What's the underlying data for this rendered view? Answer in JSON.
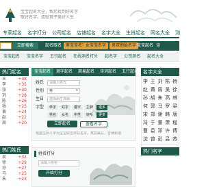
{
  "header": {
    "slogan_line1": "宝宝起名大全，帮您找到好名字",
    "slogan_line2": "取好名字，成就孩子美好人生"
  },
  "top_nav": [
    "专家起名",
    "名字打分",
    "公司起名",
    "店铺起名",
    "名字大全",
    "生肖起名",
    "网名大全",
    "测"
  ],
  "search": {
    "button_label": "立即搜索"
  },
  "green_nav": [
    {
      "label": "起名取名",
      "highlight": false
    },
    {
      "label": "男宝宝名字",
      "highlight": true
    },
    {
      "label": "女宝宝名字",
      "highlight": true
    },
    {
      "label": "男双胞胎名字",
      "highlight": true
    },
    {
      "label": "宝宝起名",
      "highlight": false
    },
    {
      "label": "诗",
      "highlight": false
    }
  ],
  "strip": [
    "宝宝起名",
    "宝宝名字",
    "五行起名",
    "在线测名打分",
    "起名字",
    "公司测名",
    "起名大全"
  ],
  "left_panel_1": {
    "title": "热门起名",
    "rows": [
      {
        "name": "王",
        "num": "+38"
      },
      {
        "name": "李",
        "num": "+35"
      },
      {
        "name": "张",
        "num": "+30"
      },
      {
        "name": "刘",
        "num": "+28"
      },
      {
        "name": "陈",
        "num": "+26"
      },
      {
        "name": "杨",
        "num": "+25"
      },
      {
        "name": "黄",
        "num": "+24"
      },
      {
        "name": "赵",
        "num": "+22"
      },
      {
        "name": "周",
        "num": "+20"
      }
    ]
  },
  "left_panel_2": {
    "title": "热门姓氏",
    "rows": [
      {
        "name": "吴",
        "num": "+32"
      },
      {
        "name": "徐",
        "num": "+29"
      },
      {
        "name": "孙",
        "num": "+27"
      },
      {
        "name": "马",
        "num": "+25"
      },
      {
        "name": "朱",
        "num": "+23"
      },
      {
        "name": "胡",
        "num": "+21"
      },
      {
        "name": "郭",
        "num": "+19"
      },
      {
        "name": "何",
        "num": "+18"
      }
    ]
  },
  "center_tabs": [
    {
      "label": "宝宝起名",
      "active": true
    },
    {
      "label": "测字起名",
      "active": false
    },
    {
      "label": "周易起名",
      "active": false
    },
    {
      "label": "诗词起名",
      "active": false
    },
    {
      "label": "五行起名",
      "active": false
    }
  ],
  "form": {
    "surname_label": "姓氏",
    "surname_placeholder": "请输入姓氏",
    "gender_label": "性别",
    "gender_value": "男",
    "birthday_label": "生日",
    "birthday_placeholder": "选择出生日期",
    "options_label": "字型",
    "chips_row1": [
      "单字",
      "双字",
      "叠字",
      "生僻",
      "更多"
    ],
    "chips_row2": [
      "男名",
      "女名",
      "中性",
      "好听",
      "更多"
    ],
    "submit_label": "立即起名",
    "secondary_label": "查看名字",
    "note": "根据生辰八字为宝宝取吉祥好名字，寓意美好，音律和谐"
  },
  "center_bottom": {
    "title": "姓名打分",
    "placeholder": "请输入姓名",
    "button_label": "开始打分"
  },
  "right_panel": {
    "title": "名字大全",
    "grid": [
      [
        "李",
        "王",
        "刘",
        "陈",
        "杨"
      ],
      [
        "赵",
        "黄",
        "周",
        "吴",
        "徐"
      ],
      [
        "孙",
        "胡",
        "朱",
        "高",
        "林"
      ],
      [
        "何",
        "郭",
        "马",
        "罗",
        "梁"
      ],
      [
        "宋",
        "郑",
        "谢",
        "韩",
        "唐"
      ],
      [
        "冯",
        "于",
        "董",
        "萧",
        "程"
      ],
      [
        "曹",
        "袁",
        "邓",
        "许",
        "傅"
      ],
      [
        "沈",
        "曾",
        "彭",
        "吕",
        "苏"
      ]
    ],
    "title2": "热门名字"
  },
  "colors": {
    "brand": "#1d5a4a",
    "accent": "#e9a23b",
    "number": "#dd3333"
  }
}
